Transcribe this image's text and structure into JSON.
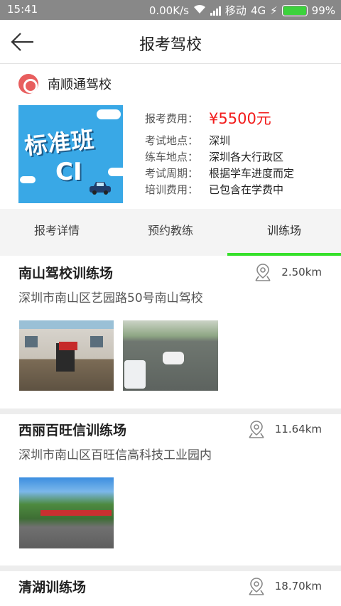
{
  "status_bar": {
    "time": "15:41",
    "net_speed": "0.00K/s",
    "carrier": "移动",
    "network": "4G",
    "battery": "99%"
  },
  "header": {
    "title": "报考驾校"
  },
  "school": {
    "name": "南顺通驾校",
    "banner_line1": "标准班",
    "banner_line2": "CI",
    "details": [
      {
        "label": "报考费用：",
        "value": "¥5500元"
      },
      {
        "label": "考试地点：",
        "value": "深圳"
      },
      {
        "label": "练车地点：",
        "value": "深圳各大行政区"
      },
      {
        "label": "考试周期：",
        "value": "根据学车进度而定"
      },
      {
        "label": "培训费用：",
        "value": "已包含在学费中"
      }
    ]
  },
  "tabs": [
    {
      "label": "报考详情",
      "active": false
    },
    {
      "label": "预约教练",
      "active": false
    },
    {
      "label": "训练场",
      "active": true
    }
  ],
  "venues": [
    {
      "name": "南山驾校训练场",
      "distance": "2.50km",
      "address": "深圳市南山区艺园路50号南山驾校"
    },
    {
      "name": "西丽百旺信训练场",
      "distance": "11.64km",
      "address": "深圳市南山区百旺信高科技工业园内"
    },
    {
      "name": "清湖训练场",
      "distance": "18.70km",
      "address": ""
    }
  ],
  "colors": {
    "accent_green": "#35e02a",
    "price_red": "#f21b1b",
    "status_bar": "#888888"
  }
}
